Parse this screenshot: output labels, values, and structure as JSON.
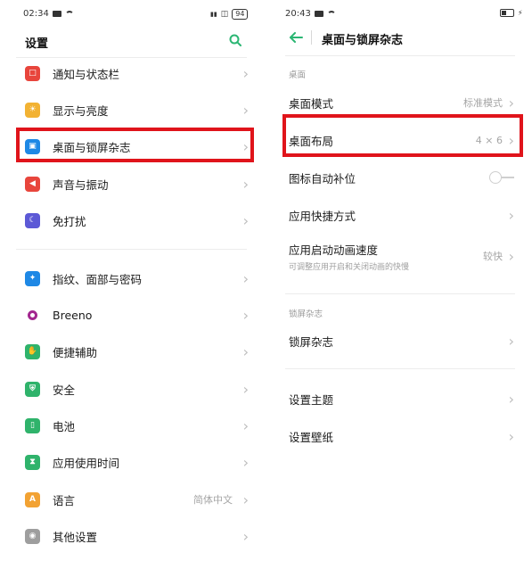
{
  "left": {
    "status": {
      "time": "02:34",
      "battery": "94"
    },
    "title": "设置",
    "icons": {
      "search": "search-icon"
    },
    "items": [
      {
        "label": "通知与状态栏",
        "color": "#e8453c"
      },
      {
        "label": "显示与亮度",
        "color": "#f2b233"
      },
      {
        "label": "桌面与锁屏杂志",
        "color": "#1e88e5"
      },
      {
        "label": "声音与振动",
        "color": "#e8453c"
      },
      {
        "label": "免打扰",
        "color": "#5c59d6"
      },
      {
        "label": "指纹、面部与密码",
        "color": "#1e88e5"
      },
      {
        "label": "Breeno",
        "color": "#a3278f"
      },
      {
        "label": "便捷辅助",
        "color": "#2fb36b"
      },
      {
        "label": "安全",
        "color": "#2fb36b"
      },
      {
        "label": "电池",
        "color": "#2fb36b"
      },
      {
        "label": "应用使用时间",
        "color": "#2fb36b"
      },
      {
        "label": "语言",
        "value": "简体中文",
        "color": "#f2a233"
      },
      {
        "label": "其他设置",
        "color": "#9e9e9e"
      }
    ]
  },
  "right": {
    "status": {
      "time": "20:43"
    },
    "title": "桌面与锁屏杂志",
    "section_desktop": "桌面",
    "section_lock": "锁屏杂志",
    "rows": {
      "mode": {
        "label": "桌面模式",
        "value": "标准模式"
      },
      "layout": {
        "label": "桌面布局",
        "value": "4 × 6"
      },
      "autofill": {
        "label": "图标自动补位"
      },
      "shortcut": {
        "label": "应用快捷方式"
      },
      "anim": {
        "label": "应用启动动画速度",
        "sub": "可调整应用开启和关闭动画的快慢",
        "value": "较快"
      },
      "lockmag": {
        "label": "锁屏杂志"
      },
      "theme": {
        "label": "设置主题"
      },
      "wallpaper": {
        "label": "设置壁纸"
      }
    }
  },
  "colors": {
    "accent": "#2bb673",
    "highlight": "#e0141b"
  }
}
